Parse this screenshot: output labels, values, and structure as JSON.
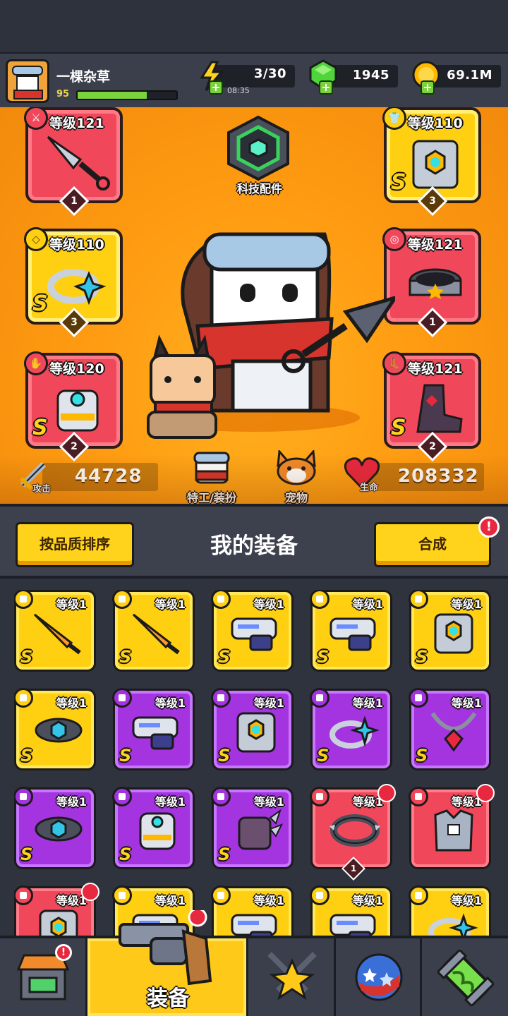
{
  "player": {
    "name": "一棵杂草",
    "level": "95",
    "xp_fraction": 0.7
  },
  "resources": {
    "energy": {
      "value": "3/30",
      "timer": "08:35",
      "icon": "lightning-icon",
      "color": "#ffd21b"
    },
    "gems": {
      "value": "1945",
      "icon": "green-gem-icon",
      "color": "#4fd43a"
    },
    "coins": {
      "value": "69.1M",
      "icon": "gold-coin-icon",
      "color": "#ffb800"
    }
  },
  "tech": {
    "label": "科技配件"
  },
  "equipped": {
    "weapon": {
      "level": "等级121",
      "count": "1",
      "rarity": "red"
    },
    "armor": {
      "level": "等级110",
      "rank": "S",
      "count": "3",
      "rarity": "gold"
    },
    "ring": {
      "level": "等级110",
      "rank": "S",
      "count": "3",
      "rarity": "gold"
    },
    "belt": {
      "level": "等级121",
      "count": "1",
      "rarity": "red"
    },
    "glove": {
      "level": "等级120",
      "rank": "S",
      "count": "2",
      "rarity": "red"
    },
    "boots": {
      "level": "等级121",
      "rank": "S",
      "count": "2",
      "rarity": "red"
    }
  },
  "stats": {
    "attack": {
      "label": "攻击",
      "value": "44728"
    },
    "hp": {
      "label": "生命",
      "value": "208332"
    }
  },
  "hero_buttons": {
    "agent": "特工/装扮",
    "pet": "宠物"
  },
  "panel": {
    "sort_label": "按品质排序",
    "title": "我的装备",
    "merge_label": "合成",
    "alert": "!"
  },
  "items": [
    {
      "level": "等级1",
      "rank": "S",
      "rarity": "gold",
      "type": "sword"
    },
    {
      "level": "等级1",
      "rank": "S",
      "rarity": "gold",
      "type": "sword"
    },
    {
      "level": "等级1",
      "rank": "S",
      "rarity": "gold",
      "type": "blaster"
    },
    {
      "level": "等级1",
      "rank": "S",
      "rarity": "gold",
      "type": "blaster"
    },
    {
      "level": "等级1",
      "rank": "S",
      "rarity": "gold",
      "type": "armor"
    },
    {
      "level": "等级1",
      "rank": "S",
      "rarity": "gold",
      "type": "belt"
    },
    {
      "level": "等级1",
      "rank": "S",
      "rarity": "purple",
      "type": "blaster"
    },
    {
      "level": "等级1",
      "rank": "S",
      "rarity": "purple",
      "type": "armor"
    },
    {
      "level": "等级1",
      "rank": "S",
      "rarity": "purple",
      "type": "ring"
    },
    {
      "level": "等级1",
      "rank": "S",
      "rarity": "purple",
      "type": "necklace"
    },
    {
      "level": "等级1",
      "rank": "S",
      "rarity": "purple",
      "type": "belt"
    },
    {
      "level": "等级1",
      "rank": "S",
      "rarity": "purple",
      "type": "glove"
    },
    {
      "level": "等级1",
      "rank": "S",
      "rarity": "purple",
      "type": "claw"
    },
    {
      "level": "等级1",
      "rank": "",
      "rarity": "red",
      "type": "collar",
      "count": "1",
      "badge": true
    },
    {
      "level": "等级1",
      "rank": "",
      "rarity": "red",
      "type": "vest",
      "badge": true
    },
    {
      "level": "等级1",
      "rank": "",
      "rarity": "red",
      "type": "armor",
      "badge": true
    },
    {
      "level": "等级1",
      "rank": "",
      "rarity": "gold",
      "type": "blaster"
    },
    {
      "level": "等级1",
      "rank": "",
      "rarity": "gold",
      "type": "blaster"
    },
    {
      "level": "等级1",
      "rank": "",
      "rarity": "gold",
      "type": "blaster"
    },
    {
      "level": "等级1",
      "rank": "",
      "rarity": "gold",
      "type": "ring"
    }
  ],
  "nav": {
    "tabs": [
      {
        "name": "shop",
        "icon": "shop-icon",
        "badge": "!"
      },
      {
        "name": "equipment",
        "label": "装备",
        "icon": "revolver-icon",
        "active": true
      },
      {
        "name": "battle",
        "icon": "crossed-swords-star-icon"
      },
      {
        "name": "talent",
        "icon": "planet-icon"
      },
      {
        "name": "gene",
        "icon": "dna-capsule-icon"
      }
    ]
  }
}
